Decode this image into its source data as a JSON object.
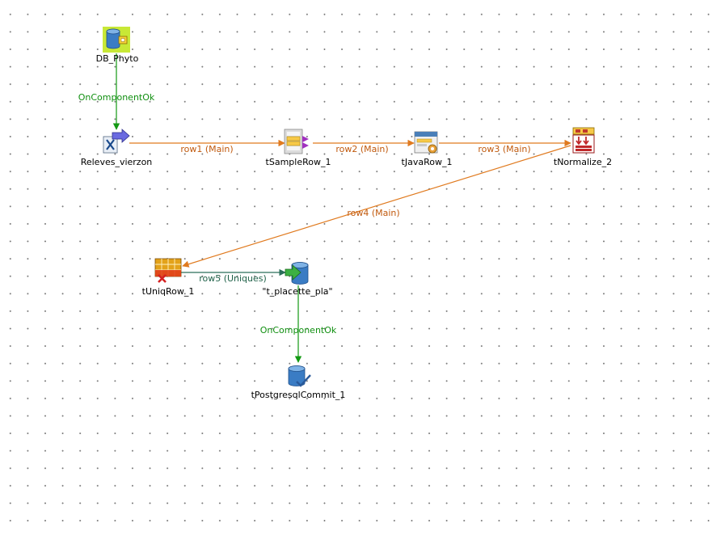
{
  "canvas": {
    "components": [
      {
        "id": "db_phyto",
        "label": "DB_Phyto"
      },
      {
        "id": "releves_vierzon",
        "label": "Releves_vierzon"
      },
      {
        "id": "tsamplerow_1",
        "label": "tSampleRow_1"
      },
      {
        "id": "tjavarow_1",
        "label": "tJavaRow_1"
      },
      {
        "id": "tnormalize_2",
        "label": "tNormalize_2"
      },
      {
        "id": "tuniqrow_1",
        "label": "tUniqRow_1"
      },
      {
        "id": "t_placette_pla",
        "label": "\"t_placette_pla\""
      },
      {
        "id": "tpostgresqlcommit_1",
        "label": "tPostgresqlCommit_1"
      }
    ],
    "links": [
      {
        "id": "link_oncomponentok_1",
        "label": "OnComponentOk",
        "type": "trigger"
      },
      {
        "id": "link_row1",
        "label": "row1 (Main)",
        "type": "main"
      },
      {
        "id": "link_row2",
        "label": "row2 (Main)",
        "type": "main"
      },
      {
        "id": "link_row3",
        "label": "row3 (Main)",
        "type": "main"
      },
      {
        "id": "link_row4",
        "label": "row4 (Main)",
        "type": "main"
      },
      {
        "id": "link_row5",
        "label": "row5 (Uniques)",
        "type": "uniques"
      },
      {
        "id": "link_oncomponentok_2",
        "label": "OnComponentOk",
        "type": "trigger"
      }
    ]
  },
  "colors": {
    "main_link": "#e07a1f",
    "trigger_link": "#139913",
    "uniques_link": "#2a6e5a",
    "main_label": "#c15a0e",
    "trigger_label": "#108f10",
    "uniques_label": "#1f6148",
    "db_blue": "#3a7cc4",
    "selection_highlight": "#c8e836"
  },
  "icons": {
    "db_phyto": "database-input-icon",
    "releves_vierzon": "excel-input-icon",
    "tsamplerow_1": "sample-row-icon",
    "tjavarow_1": "java-row-icon",
    "tnormalize_2": "normalize-icon",
    "tuniqrow_1": "uniq-row-icon",
    "t_placette_pla": "database-output-icon",
    "tpostgresqlcommit_1": "database-commit-icon"
  }
}
